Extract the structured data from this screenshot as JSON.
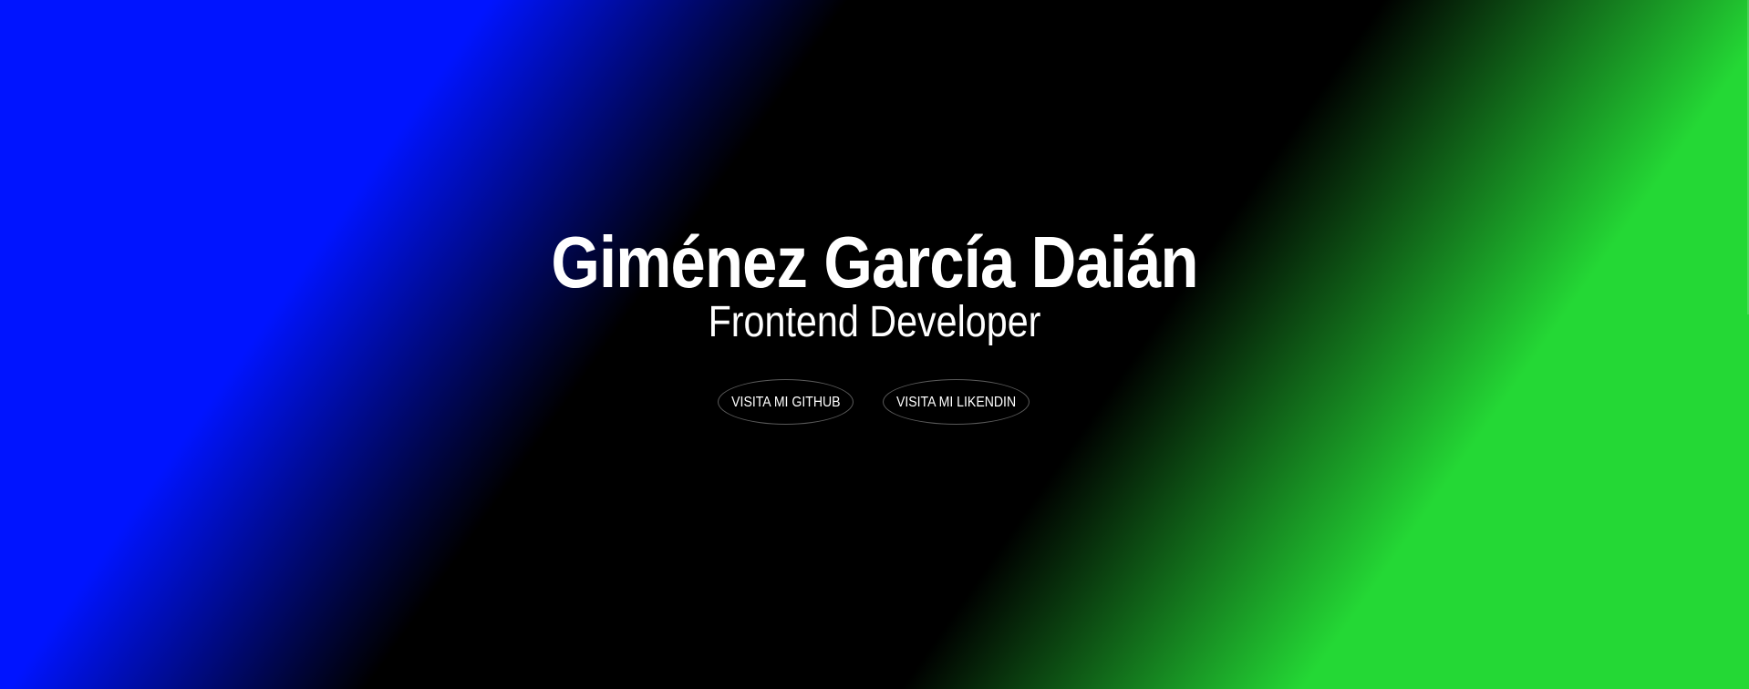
{
  "hero": {
    "name": "Giménez García Daián",
    "role": "Frontend Developer"
  },
  "buttons": {
    "github_label": "VISITA MI GITHUB",
    "linkedin_label": "VISITA MI LIKENDIN"
  },
  "colors": {
    "background": "#000000",
    "gradient_left": "#0014ff",
    "gradient_right": "#24d835",
    "text": "#ffffff",
    "button_border": "#5a5a5a"
  }
}
